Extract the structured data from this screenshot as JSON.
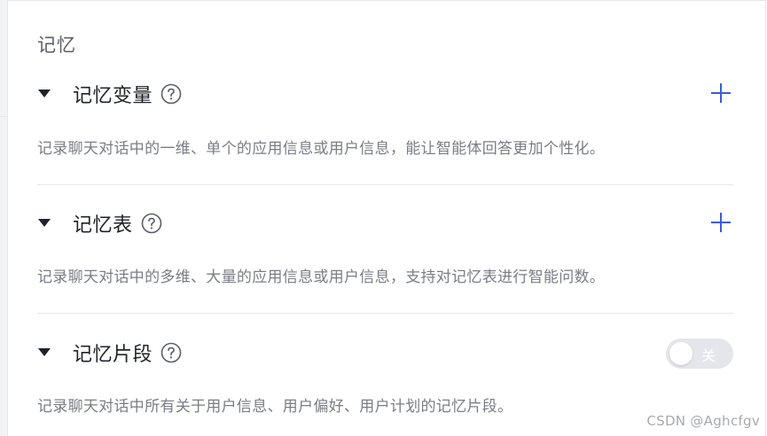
{
  "panel": {
    "title": "记忆"
  },
  "sections": [
    {
      "title": "记忆变量",
      "description": "记录聊天对话中的一维、单个的应用信息或用户信息，能让智能体回答更加个性化。",
      "action": "add"
    },
    {
      "title": "记忆表",
      "description": "记录聊天对话中的多维、大量的应用信息或用户信息，支持对记忆表进行智能问数。",
      "action": "add"
    },
    {
      "title": "记忆片段",
      "description": "记录聊天对话中所有关于用户信息、用户偏好、用户计划的记忆片段。",
      "action": "toggle",
      "toggle_label": "关",
      "toggle_on": false
    }
  ],
  "icons": {
    "caret": "caret-down-icon",
    "help": "question-circle-icon",
    "add": "plus-icon"
  },
  "colors": {
    "accent": "#3b5bdb",
    "title_text": "#1f2329",
    "desc_text": "#7a7d85",
    "toggle_off_bg": "#e5e6eb"
  },
  "watermark": "CSDN @Aghcfgv"
}
